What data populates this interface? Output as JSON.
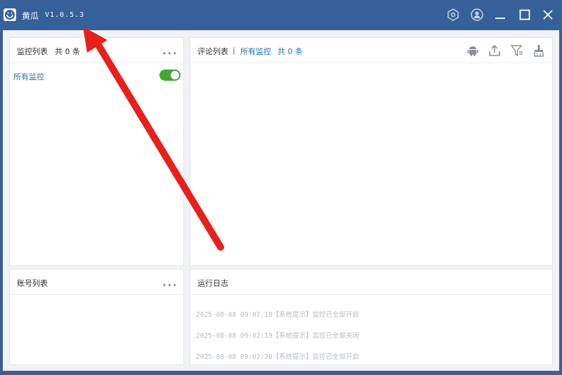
{
  "app": {
    "title": "黄瓜",
    "version": "V1.0.5.3"
  },
  "monitor_panel": {
    "title": "监控列表",
    "count_text": "共 0 条",
    "more": "•••",
    "item_label": "所有监控",
    "item_enabled": true
  },
  "comment_panel": {
    "title": "评论列表",
    "separator": "|",
    "filter_link": "所有监控",
    "count_text": "共 0 条",
    "toolbar_icons": [
      "android-icon",
      "upload-icon",
      "filter-icon",
      "clear-brush-icon"
    ]
  },
  "account_panel": {
    "title": "账号列表",
    "more": "•••"
  },
  "log_panel": {
    "title": "运行日志",
    "lines": [
      "2025-08-08 09:02:18【系统提示】监控已全部开启",
      "2025-08-08 09:02:19【系统提示】监控已全部关闭",
      "2025-08-08 09:02:20【系统提示】监控已全部开启"
    ]
  },
  "colors": {
    "titlebar": "#36609a",
    "accent_link": "#1f72c6",
    "toggle_on": "#3fa933",
    "annotation_arrow": "#e8201b"
  }
}
